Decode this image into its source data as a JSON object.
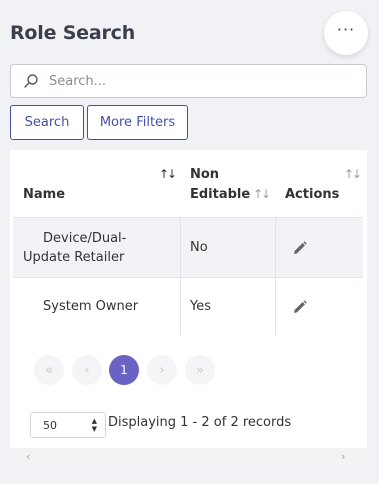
{
  "page": {
    "title": "Role Search",
    "more_icon": "ellipsis-icon"
  },
  "search": {
    "placeholder": "Search...",
    "value": "",
    "icon": "search-icon"
  },
  "buttons": {
    "search_label": "Search",
    "more_filters_label": "More Filters"
  },
  "table": {
    "columns": [
      {
        "label": "Name",
        "sort": "asc"
      },
      {
        "label_line1": "Non",
        "label_line2": "Editable",
        "sort": "none"
      },
      {
        "label": "Actions",
        "sort": "none"
      }
    ],
    "rows": [
      {
        "name_line1": "Device/Dual-",
        "name_line2": "Update Retailer",
        "non_editable": "No",
        "action_icon": "edit-pencil-icon"
      },
      {
        "name": "System Owner",
        "non_editable": "Yes",
        "action_icon": "edit-pencil-icon"
      }
    ]
  },
  "pagination": {
    "first": "«",
    "prev": "‹",
    "current": "1",
    "next": "›",
    "last": "»"
  },
  "footer": {
    "page_size": "50",
    "records_text": "Displaying 1 - 2 of 2 records"
  },
  "colors": {
    "accent": "#4451a3",
    "current_page": "#6b63c4",
    "background": "#f1f2f6"
  }
}
